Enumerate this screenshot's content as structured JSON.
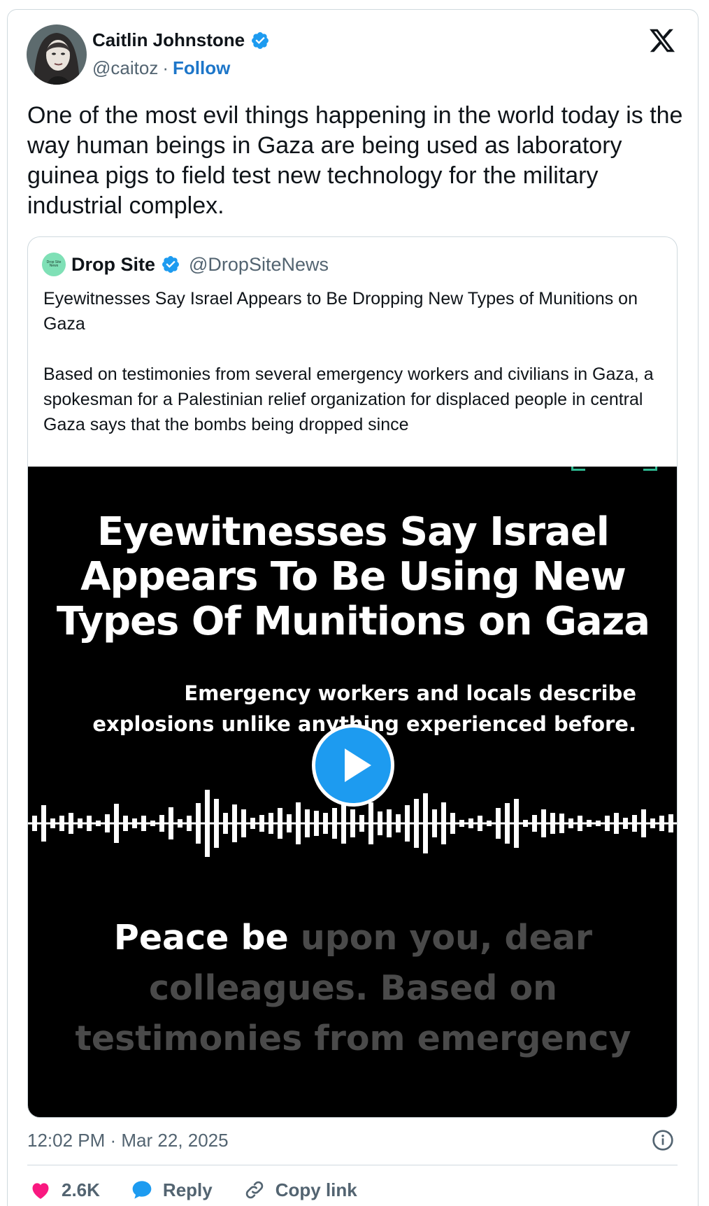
{
  "author": {
    "name": "Caitlin Johnstone",
    "handle": "@caitoz",
    "separator": "·",
    "follow_label": "Follow"
  },
  "tweet": {
    "text": "One of the most evil things happening in the world today is the way human beings in Gaza are being used as laboratory guinea pigs to field test new technology for the military industrial complex."
  },
  "quoted": {
    "avatar_text": "Drop Site News",
    "name": "Drop Site",
    "handle": "@DropSiteNews",
    "title": "Eyewitnesses Say Israel Appears to Be Dropping New Types of Munitions on Gaza",
    "body": "Based on testimonies from several emergency workers and civilians in Gaza, a spokesman for a Palestinian relief organization for displaced people in central Gaza says that the bombs being dropped since",
    "video": {
      "headline": "Eyewitnesses Say Israel Appears To Be Using New Types Of Munitions on Gaza",
      "subhead": "Emergency workers and locals describe explosions unlike anything experienced before.",
      "caption_spoken": "Peace be",
      "caption_upcoming": "upon you, dear colleagues. Based on testimonies from emergency"
    }
  },
  "meta": {
    "timestamp": "12:02 PM · Mar 22, 2025"
  },
  "actions": {
    "likes": "2.6K",
    "reply_label": "Reply",
    "copy_label": "Copy link"
  },
  "colors": {
    "accent": "#1d9bf0",
    "like": "#f91880",
    "text": "#0f1419",
    "muted": "#536471"
  }
}
